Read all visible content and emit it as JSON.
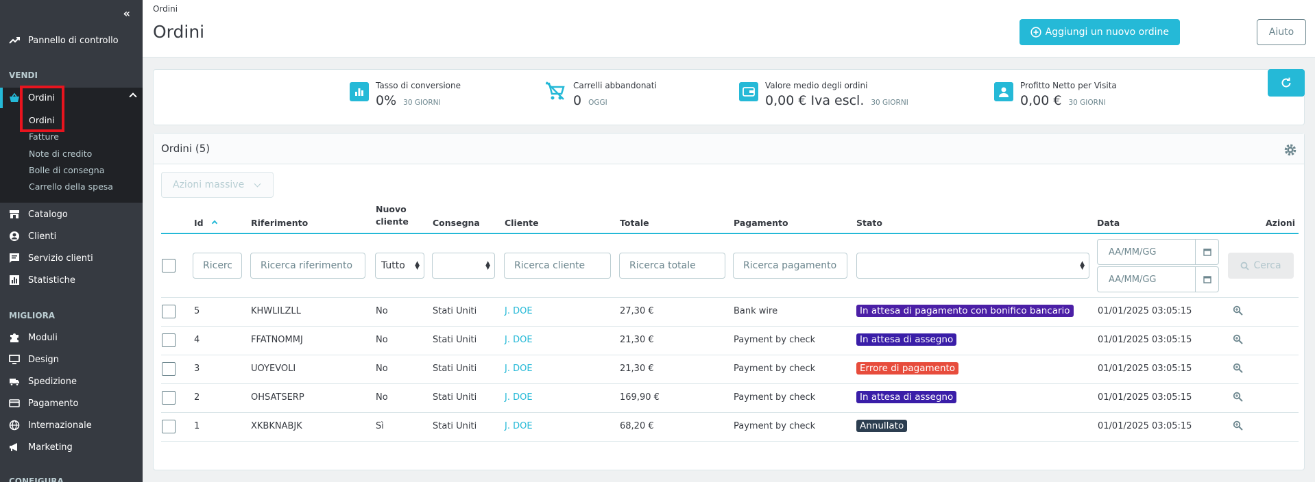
{
  "sidebar": {
    "collapse_label": "«",
    "dashboard": "Pannello di controllo",
    "section_sell": "VENDI",
    "orders": "Ordini",
    "sub_items": [
      "Ordini",
      "Fatture",
      "Note di credito",
      "Bolle di consegna",
      "Carrello della spesa"
    ],
    "catalog": "Catalogo",
    "customers": "Clienti",
    "customer_service": "Servizio clienti",
    "stats": "Statistiche",
    "section_improve": "MIGLIORA",
    "modules": "Moduli",
    "design": "Design",
    "shipping": "Spedizione",
    "payment": "Pagamento",
    "international": "Internazionale",
    "marketing": "Marketing",
    "section_configure": "CONFIGURA"
  },
  "header": {
    "breadcrumb": "Ordini",
    "title": "Ordini",
    "add_button": "Aggiungi un nuovo ordine",
    "help_button": "Aiuto"
  },
  "kpis": [
    {
      "label": "Tasso di conversione",
      "value": "0%",
      "period": "30 GIORNI"
    },
    {
      "label": "Carrelli abbandonati",
      "value": "0",
      "period": "OGGI"
    },
    {
      "label": "Valore medio degli ordini",
      "value": "0,00 € Iva escl.",
      "period": "30 GIORNI"
    },
    {
      "label": "Profitto Netto per Visita",
      "value": "0,00 €",
      "period": "30 GIORNI"
    }
  ],
  "orders": {
    "title": "Ordini (5)",
    "bulk_actions": "Azioni massive",
    "columns": {
      "id": "Id",
      "reference": "Riferimento",
      "new_customer_1": "Nuovo",
      "new_customer_2": "cliente",
      "delivery": "Consegna",
      "customer": "Cliente",
      "total": "Totale",
      "payment": "Pagamento",
      "status": "Stato",
      "date": "Data",
      "actions": "Azioni"
    },
    "filters": {
      "id_placeholder": "Ricerca",
      "reference_placeholder": "Ricerca riferimento",
      "new_customer_value": "Tutto",
      "customer_placeholder": "Ricerca cliente",
      "total_placeholder": "Ricerca totale",
      "payment_placeholder": "Ricerca pagamento",
      "date_from": "AA/MM/GG",
      "date_to": "AA/MM/GG",
      "search_button": "Cerca"
    },
    "rows": [
      {
        "id": "5",
        "reference": "KHWLILZLL",
        "new_customer": "No",
        "delivery": "Stati Uniti",
        "customer": "J. DOE",
        "total": "27,30 €",
        "payment": "Bank wire",
        "status": "In attesa di pagamento con bonifico bancario",
        "status_color": "#4b1fa6",
        "date": "01/01/2025 03:05:15"
      },
      {
        "id": "4",
        "reference": "FFATNOMMJ",
        "new_customer": "No",
        "delivery": "Stati Uniti",
        "customer": "J. DOE",
        "total": "21,30 €",
        "payment": "Payment by check",
        "status": "In attesa di assegno",
        "status_color": "#3a1ea8",
        "date": "01/01/2025 03:05:15"
      },
      {
        "id": "3",
        "reference": "UOYEVOLI",
        "new_customer": "No",
        "delivery": "Stati Uniti",
        "customer": "J. DOE",
        "total": "21,30 €",
        "payment": "Payment by check",
        "status": "Errore di pagamento",
        "status_color": "#e74c3c",
        "date": "01/01/2025 03:05:15"
      },
      {
        "id": "2",
        "reference": "OHSATSERP",
        "new_customer": "No",
        "delivery": "Stati Uniti",
        "customer": "J. DOE",
        "total": "169,90 €",
        "payment": "Payment by check",
        "status": "In attesa di assegno",
        "status_color": "#3a1ea8",
        "date": "01/01/2025 03:05:15"
      },
      {
        "id": "1",
        "reference": "XKBKNABJK",
        "new_customer": "Sì",
        "delivery": "Stati Uniti",
        "customer": "J. DOE",
        "total": "68,20 €",
        "payment": "Payment by check",
        "status": "Annullato",
        "status_color": "#2c3e50",
        "date": "01/01/2025 03:05:15"
      }
    ]
  }
}
